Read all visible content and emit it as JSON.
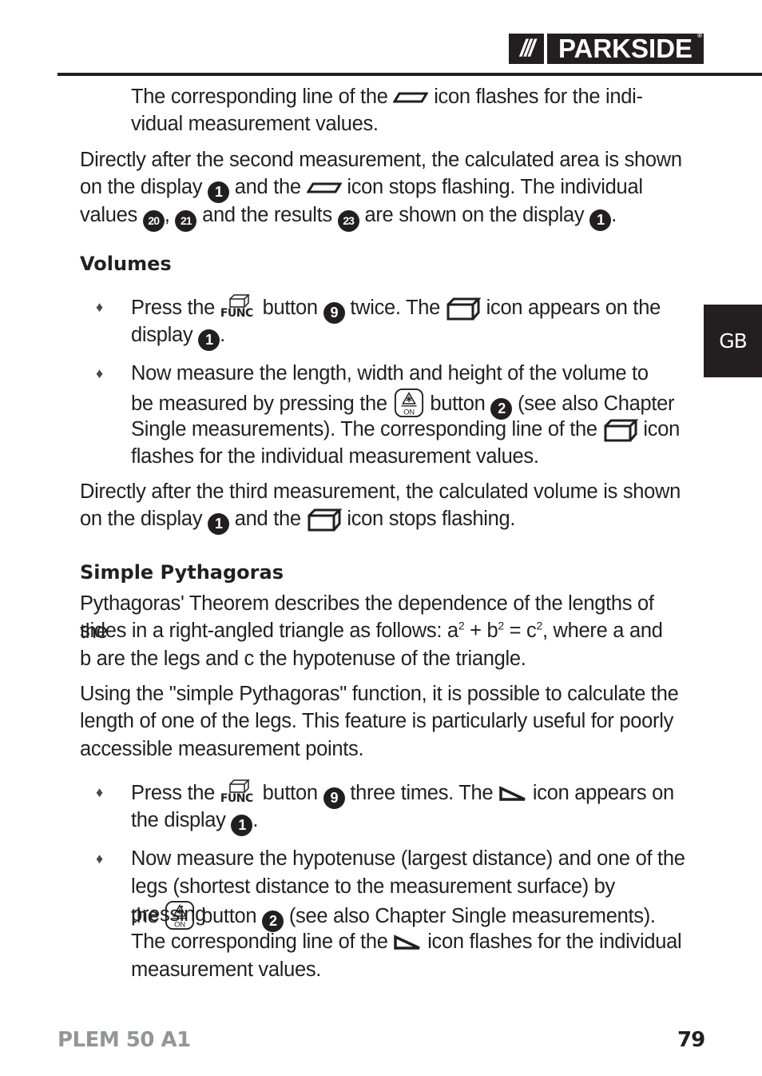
{
  "header": {
    "logo_slashes": "///",
    "logo_text": "PARKSIDE",
    "logo_registered": "®"
  },
  "side_tab": {
    "language": "GB"
  },
  "content": {
    "intro": {
      "line1_a": "The corresponding line of the",
      "line1_b": "icon flashes for the indi-",
      "line2": "vidual measurement values."
    },
    "area_result": {
      "l1": "Directly after the second measurement, the calculated area is shown",
      "l2_a": "on the display",
      "l2_b": "and the",
      "l2_c": "icon stops flashing. The individual",
      "l3_a": "values",
      "l3_b": ",",
      "l3_c": "and the results",
      "l3_d": "are shown on the display",
      "l3_e": "."
    },
    "volumes": {
      "heading": "Volumes",
      "bullet1": {
        "a": "Press the",
        "b": "button",
        "c": "twice. The",
        "d": "icon appears on the",
        "e": "display",
        "f": "."
      },
      "bullet2": {
        "l1": "Now measure the length, width and height of the volume to",
        "l2_a": "be measured by pressing the",
        "l2_b": "button",
        "l2_c": "(see also Chapter",
        "l3_a": "Single measurements). The corresponding line of the",
        "l3_b": "icon",
        "l4": "flashes for the individual measurement values."
      },
      "result": {
        "l1": "Directly after the third measurement, the calculated volume is shown",
        "l2_a": "on the display",
        "l2_b": "and the",
        "l2_c": "icon stops flashing."
      }
    },
    "pythagoras": {
      "heading": "Simple Pythagoras",
      "p1": {
        "l1": "Pythagoras' Theorem describes the dependence of the lengths of the",
        "l2_a": "sides in a right-angled triangle as follows: a",
        "sup": "2",
        "l2_b": " + b",
        "l2_c": " = c",
        "l2_d": ", where a and",
        "l3": "b are the legs and c the hypotenuse of the triangle."
      },
      "p2": {
        "l1": "Using the \"simple Pythagoras\" function, it is possible to calculate the",
        "l2": "length of one of the legs. This feature is particularly useful for poorly",
        "l3": "accessible measurement points."
      },
      "bullet1": {
        "a": "Press the",
        "b": "button",
        "c": "three times. The",
        "d": "icon appears on",
        "e": "the display",
        "f": "."
      },
      "bullet2": {
        "l1": "Now measure the hypotenuse (largest distance) and one of the",
        "l2": "legs (shortest distance to the measurement surface) by pressing",
        "l3_a": "the",
        "l3_b": "button",
        "l3_c": "(see also Chapter Single measurements).",
        "l4_a": "The corresponding line of the",
        "l4_b": "icon flashes for the individual",
        "l5": "measurement values."
      }
    }
  },
  "refs": {
    "display": "1",
    "on_button": "2",
    "func_button": "9",
    "value_a": "20",
    "value_b": "21",
    "results": "23"
  },
  "icons": {
    "bullet": "♦",
    "func_label": "FUNC",
    "on_label": "ON"
  },
  "footer": {
    "model": "PLEM 50 A1",
    "page": "79"
  }
}
